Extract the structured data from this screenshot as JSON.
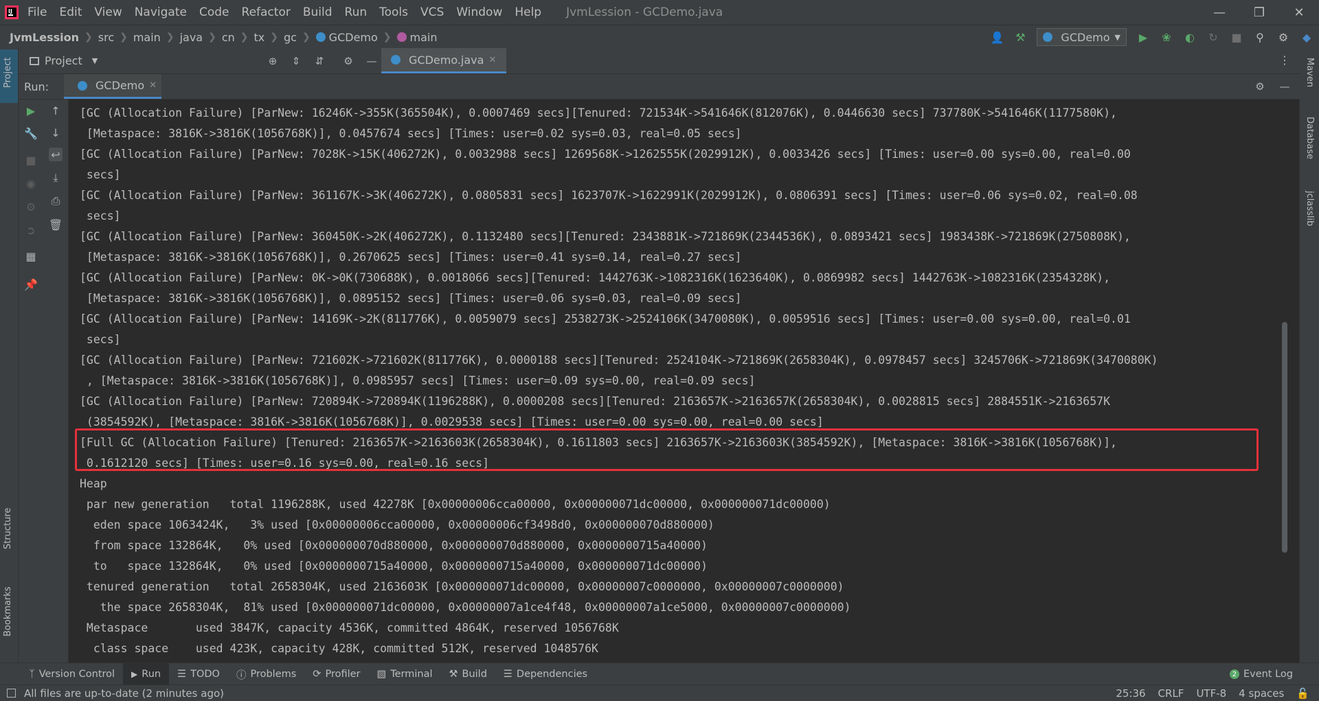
{
  "colors": {
    "accent": "#4a88c7",
    "highlight_box": "#e5313b",
    "run_green": "#59a869",
    "background": "#2b2b2b",
    "panel": "#3c3f41"
  },
  "menu": [
    "File",
    "Edit",
    "View",
    "Navigate",
    "Code",
    "Refactor",
    "Build",
    "Run",
    "Tools",
    "VCS",
    "Window",
    "Help"
  ],
  "window_title": "JvmLession - GCDemo.java",
  "breadcrumbs": [
    "JvmLession",
    "src",
    "main",
    "java",
    "cn",
    "tx",
    "gc",
    "GCDemo",
    "main"
  ],
  "run_config": "GCDemo",
  "left_stripe": {
    "top_tab": "Project",
    "structure_tab": "Structure",
    "bookmarks_tab": "Bookmarks"
  },
  "right_stripe": [
    "Maven",
    "Database",
    "jclasslib"
  ],
  "project_panel": {
    "title": "Project"
  },
  "editor_tab": {
    "label": "GCDemo.java"
  },
  "run_window": {
    "label": "Run:",
    "tab": "GCDemo"
  },
  "console_lines": [
    "[GC (Allocation Failure) [ParNew: 16246K->355K(365504K), 0.0007469 secs][Tenured: 721534K->541646K(812076K), 0.0446630 secs] 737780K->541646K(1177580K),",
    " [Metaspace: 3816K->3816K(1056768K)], 0.0457674 secs] [Times: user=0.02 sys=0.03, real=0.05 secs]",
    "[GC (Allocation Failure) [ParNew: 7028K->15K(406272K), 0.0032988 secs] 1269568K->1262555K(2029912K), 0.0033426 secs] [Times: user=0.00 sys=0.00, real=0.00",
    " secs]",
    "[GC (Allocation Failure) [ParNew: 361167K->3K(406272K), 0.0805831 secs] 1623707K->1622991K(2029912K), 0.0806391 secs] [Times: user=0.06 sys=0.02, real=0.08",
    " secs]",
    "[GC (Allocation Failure) [ParNew: 360450K->2K(406272K), 0.1132480 secs][Tenured: 2343881K->721869K(2344536K), 0.0893421 secs] 1983438K->721869K(2750808K),",
    " [Metaspace: 3816K->3816K(1056768K)], 0.2670625 secs] [Times: user=0.41 sys=0.14, real=0.27 secs]",
    "[GC (Allocation Failure) [ParNew: 0K->0K(730688K), 0.0018066 secs][Tenured: 1442763K->1082316K(1623640K), 0.0869982 secs] 1442763K->1082316K(2354328K),",
    " [Metaspace: 3816K->3816K(1056768K)], 0.0895152 secs] [Times: user=0.06 sys=0.03, real=0.09 secs]",
    "[GC (Allocation Failure) [ParNew: 14169K->2K(811776K), 0.0059079 secs] 2538273K->2524106K(3470080K), 0.0059516 secs] [Times: user=0.00 sys=0.00, real=0.01",
    " secs]",
    "[GC (Allocation Failure) [ParNew: 721602K->721602K(811776K), 0.0000188 secs][Tenured: 2524104K->721869K(2658304K), 0.0978457 secs] 3245706K->721869K(3470080K)",
    " , [Metaspace: 3816K->3816K(1056768K)], 0.0985957 secs] [Times: user=0.09 sys=0.00, real=0.09 secs]",
    "[GC (Allocation Failure) [ParNew: 720894K->720894K(1196288K), 0.0000208 secs][Tenured: 2163657K->2163657K(2658304K), 0.0028815 secs] 2884551K->2163657K",
    " (3854592K), [Metaspace: 3816K->3816K(1056768K)], 0.0029538 secs] [Times: user=0.00 sys=0.00, real=0.00 secs]",
    "[Full GC (Allocation Failure) [Tenured: 2163657K->2163603K(2658304K), 0.1611803 secs] 2163657K->2163603K(3854592K), [Metaspace: 3816K->3816K(1056768K)],",
    " 0.1612120 secs] [Times: user=0.16 sys=0.00, real=0.16 secs]",
    "Heap",
    " par new generation   total 1196288K, used 42278K [0x00000006cca00000, 0x000000071dc00000, 0x000000071dc00000)",
    "  eden space 1063424K,   3% used [0x00000006cca00000, 0x00000006cf3498d0, 0x000000070d880000)",
    "  from space 132864K,   0% used [0x000000070d880000, 0x000000070d880000, 0x0000000715a40000)",
    "  to   space 132864K,   0% used [0x0000000715a40000, 0x0000000715a40000, 0x000000071dc00000)",
    " tenured generation   total 2658304K, used 2163603K [0x000000071dc00000, 0x00000007c0000000, 0x00000007c0000000)",
    "   the space 2658304K,  81% used [0x000000071dc00000, 0x00000007a1ce4f48, 0x00000007a1ce5000, 0x00000007c0000000)",
    " Metaspace       used 3847K, capacity 4536K, committed 4864K, reserved 1056768K",
    "  class space    used 423K, capacity 428K, committed 512K, reserved 1048576K"
  ],
  "bottom_tabs": [
    "Version Control",
    "Run",
    "TODO",
    "Problems",
    "Profiler",
    "Terminal",
    "Build",
    "Dependencies"
  ],
  "event_log": "Event Log",
  "status": {
    "message": "All files are up-to-date (2 minutes ago)",
    "position": "25:36",
    "line_sep": "CRLF",
    "encoding": "UTF-8",
    "indent": "4 spaces"
  }
}
